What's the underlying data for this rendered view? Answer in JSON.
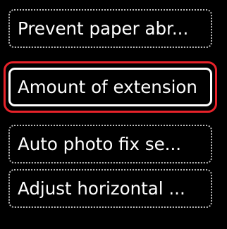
{
  "menu": {
    "items": [
      {
        "label": "Prevent paper abr..."
      },
      {
        "label": "Amount of extension"
      },
      {
        "label": "Auto photo fix se..."
      },
      {
        "label": "Adjust horizontal ..."
      }
    ],
    "selected_index": 1,
    "colors": {
      "background": "#000000",
      "text": "#ffffff",
      "focus_ring": "#e8222a",
      "item_border": "#bdbdbd"
    }
  }
}
